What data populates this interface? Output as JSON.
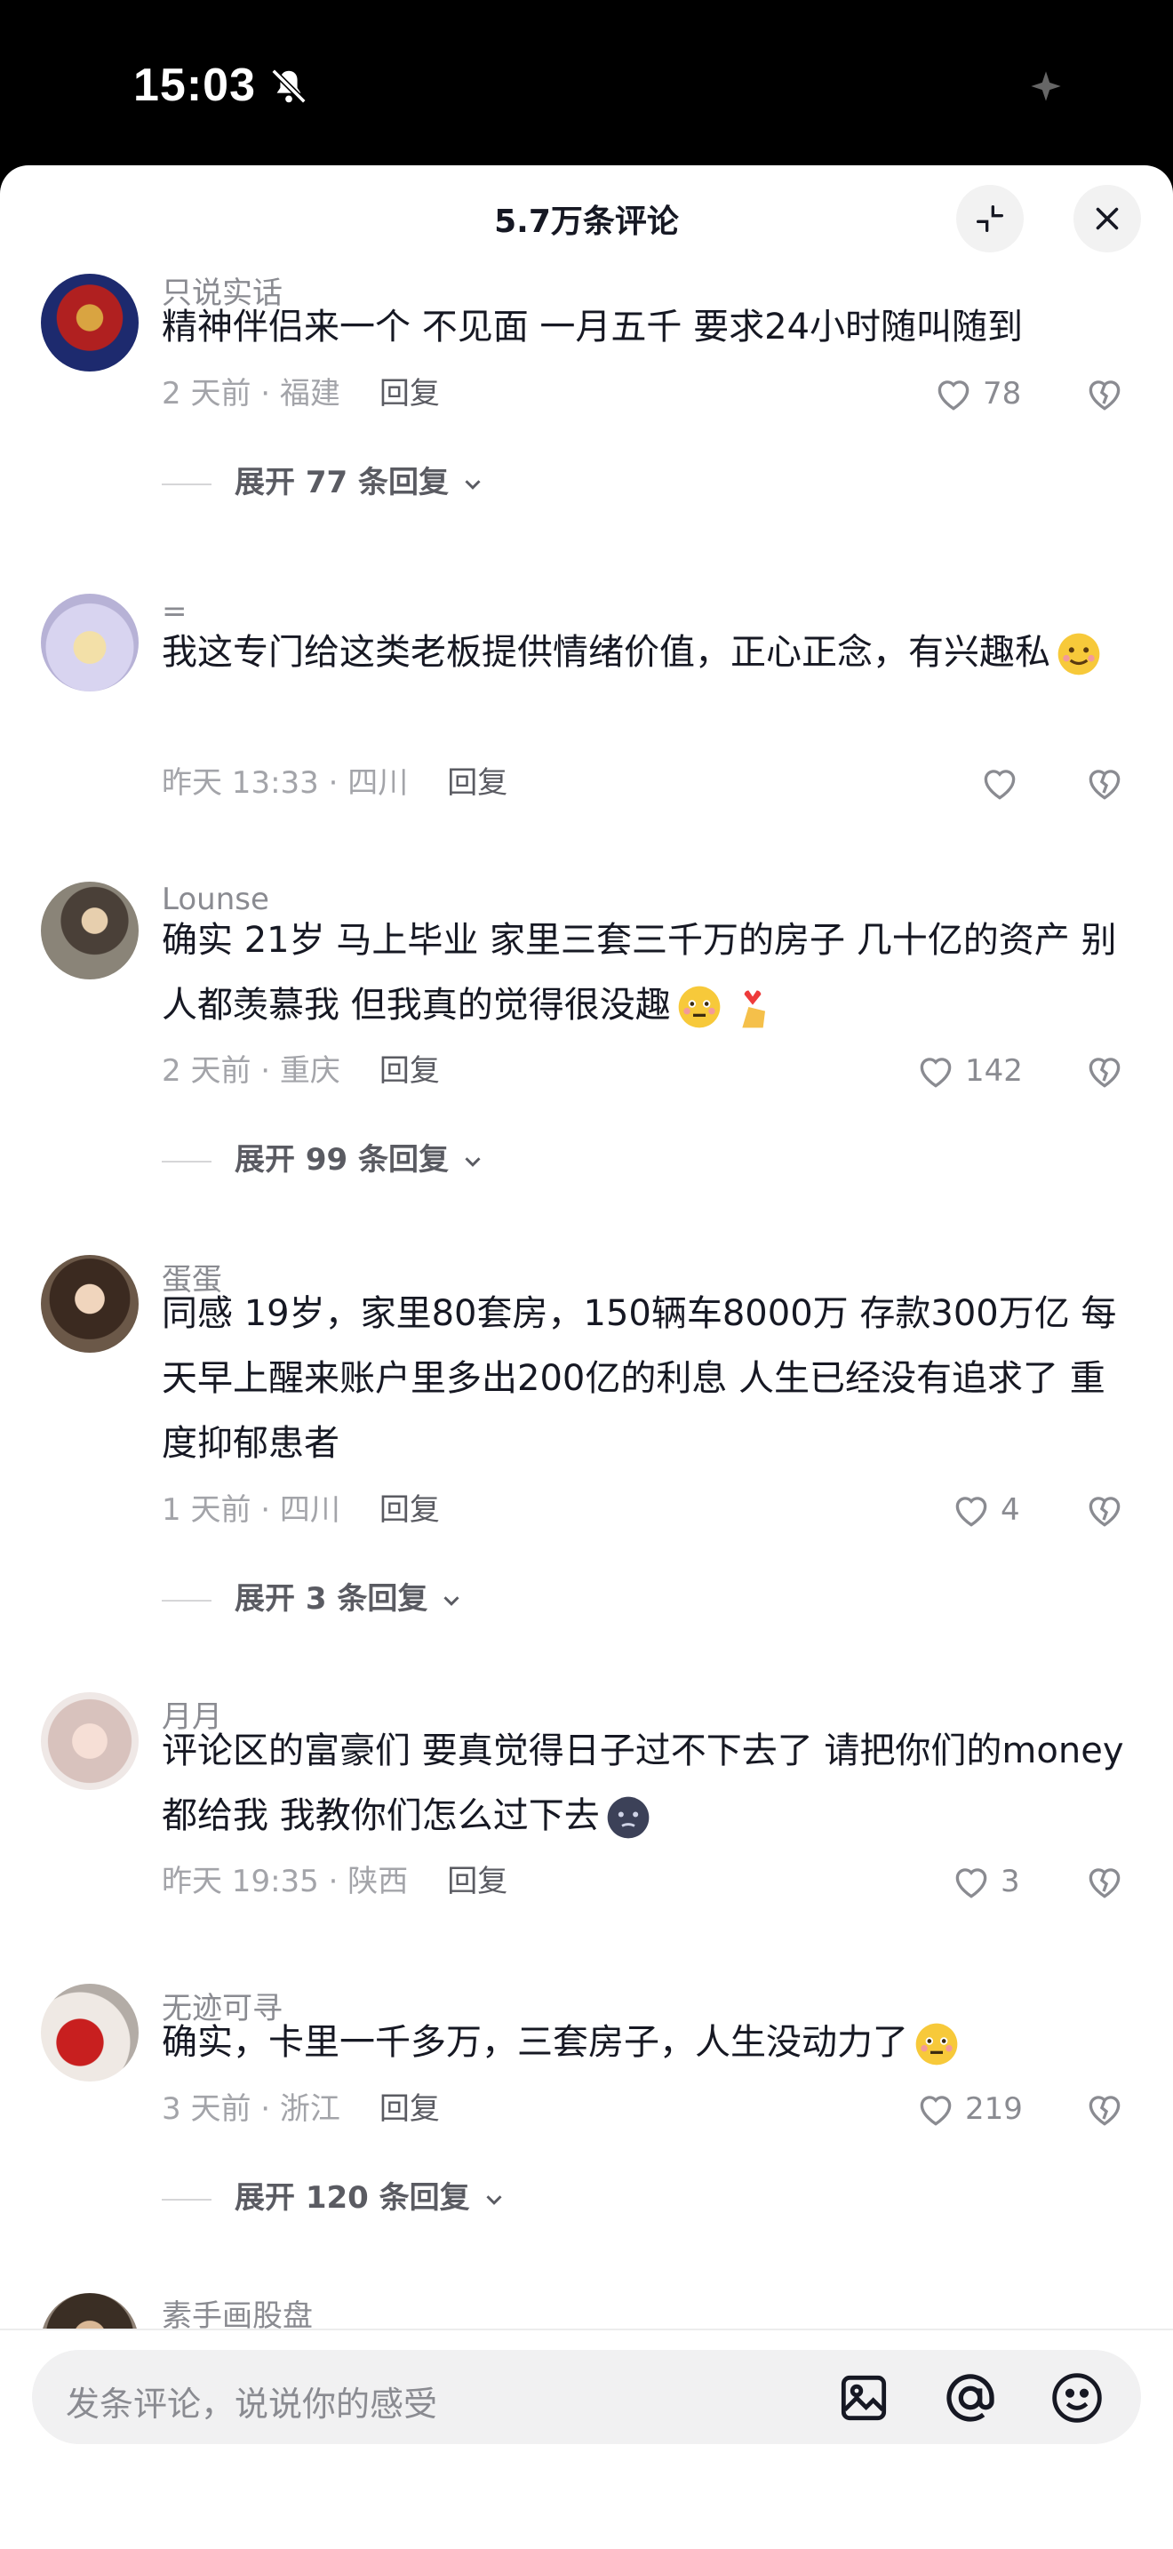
{
  "status": {
    "time": "15:03"
  },
  "header": {
    "title": "5.7万条评论"
  },
  "comments": [
    {
      "user": "只说实话",
      "text": "精神伴侣来一个 不见面 一月五千 要求24小时随叫随到",
      "time": "2 天前 · 福建",
      "reply": "回复",
      "likes": "78",
      "expand": "展开 77 条回复"
    },
    {
      "user": "=",
      "text": "我这专门给这类老板提供情绪价值，正心正念，有兴趣私",
      "time": "昨天 13:33 · 四川",
      "reply": "回复",
      "likes": "",
      "expand": ""
    },
    {
      "user": "Lounse",
      "text": "确实 21岁 马上毕业 家里三套三千万的房子 几十亿的资产 别人都羡慕我 但我真的觉得很没趣",
      "time": "2 天前 · 重庆",
      "reply": "回复",
      "likes": "142",
      "expand": "展开 99 条回复"
    },
    {
      "user": "蛋蛋",
      "text": "同感 19岁，家里80套房，150辆车8000万 存款300万亿 每天早上醒来账户里多出200亿的利息 人生已经没有追求了 重度抑郁患者",
      "time": "1 天前 · 四川",
      "reply": "回复",
      "likes": "4",
      "expand": "展开 3 条回复"
    },
    {
      "user": "月月",
      "text": "评论区的富豪们 要真觉得日子过不下去了 请把你们的money都给我 我教你们怎么过下去",
      "time": "昨天 19:35 · 陕西",
      "reply": "回复",
      "likes": "3",
      "expand": ""
    },
    {
      "user": "无迹可寻",
      "text": "确实，卡里一千多万，三套房子，人生没动力了",
      "time": "3 天前 · 浙江",
      "reply": "回复",
      "likes": "219",
      "expand": "展开 120 条回复"
    },
    {
      "user": "素手画股盘"
    }
  ],
  "input": {
    "placeholder": "发条评论，说说你的感受"
  },
  "icons": {
    "like": "heart-icon",
    "dislike": "broken-heart-icon",
    "image": "image-icon",
    "mention": "at-icon",
    "emoji": "emoji-icon"
  }
}
